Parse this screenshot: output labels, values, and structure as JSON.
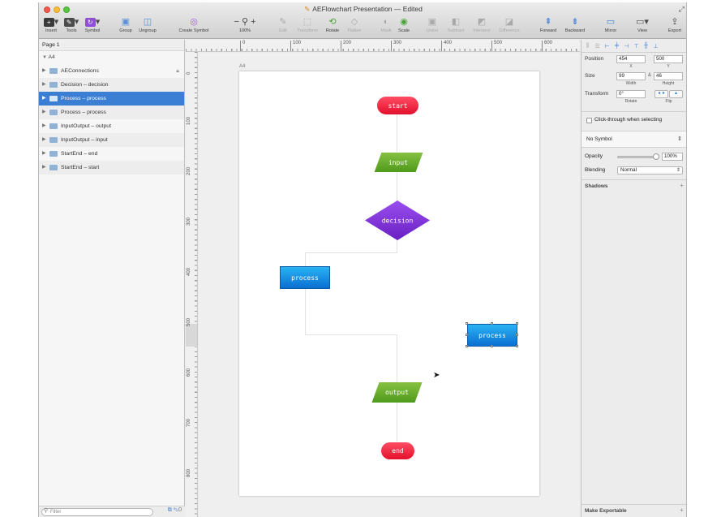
{
  "window": {
    "title": "AEFlowchart Presentation",
    "title_suffix": "— Edited",
    "doc_icon": "document-icon"
  },
  "toolbar": {
    "insert": {
      "label": "Insert",
      "icon": "plus-square-icon"
    },
    "tools": {
      "label": "Tools",
      "icon": "tools-icon"
    },
    "symbol": {
      "label": "Symbol",
      "icon": "symbol-icon"
    },
    "group": {
      "label": "Group",
      "icon": "group-icon"
    },
    "ungroup": {
      "label": "Ungroup",
      "icon": "ungroup-icon"
    },
    "create_symbol": {
      "label": "Create Symbol",
      "icon": "create-symbol-icon"
    },
    "zoom": {
      "label": "100%",
      "minus": "−",
      "plus": "+",
      "icon": "magnifier-icon"
    },
    "edit": {
      "label": "Edit"
    },
    "transform": {
      "label": "Transform"
    },
    "rotate": {
      "label": "Rotate"
    },
    "flatten": {
      "label": "Flatten"
    },
    "mask": {
      "label": "Mask"
    },
    "scale": {
      "label": "Scale"
    },
    "union": {
      "label": "Union"
    },
    "subtract": {
      "label": "Subtract"
    },
    "intersect": {
      "label": "Intersect"
    },
    "difference": {
      "label": "Difference"
    },
    "forward": {
      "label": "Forward"
    },
    "backward": {
      "label": "Backward"
    },
    "mirror": {
      "label": "Mirror"
    },
    "view": {
      "label": "View"
    },
    "export": {
      "label": "Export"
    }
  },
  "layers": {
    "page": "Page 1",
    "artboard": "A4",
    "items": [
      {
        "label": "AEConnections",
        "locked": true
      },
      {
        "label": "Decision – decision"
      },
      {
        "label": "Process – process",
        "selected": true
      },
      {
        "label": "Process – process"
      },
      {
        "label": "InputOutput – output"
      },
      {
        "label": "InputOutput – input"
      },
      {
        "label": "StartEnd – end"
      },
      {
        "label": "StartEnd – start"
      }
    ],
    "filter_placeholder": "Filter"
  },
  "ruler": {
    "h_ticks": [
      "0",
      "100",
      "200",
      "300",
      "400",
      "500",
      "600"
    ],
    "v_ticks": [
      "0",
      "100",
      "200",
      "300",
      "400",
      "500",
      "600",
      "700",
      "800"
    ]
  },
  "canvas": {
    "artboard_label": "A4",
    "shapes": {
      "start": "start",
      "input": "input",
      "decision": "decision",
      "process_left": "process",
      "process_right": "process",
      "output": "output",
      "end": "end"
    },
    "colors": {
      "start_end": "#e8172f",
      "io": "#5fa82a",
      "decision": "#7a2fd1",
      "process": "#1684e0",
      "selection": "#3b7fd4"
    }
  },
  "inspector": {
    "position_label": "Position",
    "x": "454",
    "y": "500",
    "x_sub": "X",
    "y_sub": "Y",
    "size_label": "Size",
    "width": "99",
    "height": "46",
    "width_sub": "Width",
    "height_sub": "Height",
    "transform_label": "Transform",
    "rotate_value": "0°",
    "rotate_sub": "Rotate",
    "flip_sub": "Flip",
    "click_through": "Click-through when selecting",
    "symbol": "No Symbol",
    "opacity_label": "Opacity",
    "opacity_value": "100%",
    "opacity_level": 1.0,
    "blending_label": "Blending",
    "blending_value": "Normal",
    "shadows_label": "Shadows",
    "make_exportable": "Make Exportable"
  }
}
